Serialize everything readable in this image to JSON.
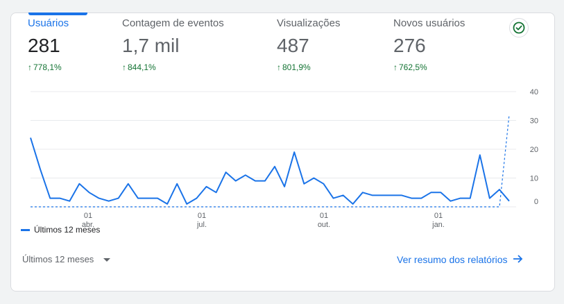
{
  "metrics": [
    {
      "label": "Usuários",
      "value": "281",
      "delta": "778,1%"
    },
    {
      "label": "Contagem de eventos",
      "value": "1,7 mil",
      "delta": "844,1%"
    },
    {
      "label": "Visualizações",
      "value": "487",
      "delta": "801,9%"
    },
    {
      "label": "Novos usuários",
      "value": "276",
      "delta": "762,5%"
    }
  ],
  "status_icon": "check-circle-icon",
  "colors": {
    "accent": "#1a73e8",
    "positive": "#137333",
    "text_muted": "#5f6368"
  },
  "chart_data": {
    "type": "line",
    "y_ticks": [
      "40",
      "30",
      "20",
      "10",
      "0"
    ],
    "ylim": [
      0,
      40
    ],
    "grid": true,
    "x_ticks": [
      {
        "day": "01",
        "month": "abr."
      },
      {
        "day": "01",
        "month": "jul."
      },
      {
        "day": "01",
        "month": "out."
      },
      {
        "day": "01",
        "month": "jan."
      }
    ],
    "series": [
      {
        "name": "Últimos 12 meses",
        "style": "solid",
        "values": [
          24,
          13,
          3,
          3,
          2,
          8,
          5,
          3,
          2,
          3,
          8,
          3,
          3,
          3,
          1,
          8,
          1,
          3,
          7,
          5,
          12,
          9,
          11,
          9,
          9,
          14,
          7,
          19,
          8,
          10,
          8,
          3,
          4,
          1,
          5,
          4,
          4,
          4,
          4,
          3,
          3,
          5,
          5,
          2,
          3,
          3,
          18,
          3,
          6,
          2
        ]
      },
      {
        "name": "",
        "style": "dashed",
        "values": [
          0,
          0,
          0,
          0,
          0,
          0,
          0,
          0,
          0,
          0,
          0,
          0,
          0,
          0,
          0,
          0,
          0,
          0,
          0,
          0,
          0,
          0,
          0,
          0,
          0,
          0,
          0,
          0,
          0,
          0,
          0,
          0,
          0,
          0,
          0,
          0,
          0,
          0,
          0,
          0,
          0,
          0,
          0,
          0,
          0,
          0,
          0,
          0,
          0,
          32
        ]
      }
    ]
  },
  "legend": {
    "label": "Últimos 12 meses"
  },
  "footer": {
    "range_label": "Últimos 12 meses",
    "report_link": "Ver resumo dos relatórios"
  }
}
